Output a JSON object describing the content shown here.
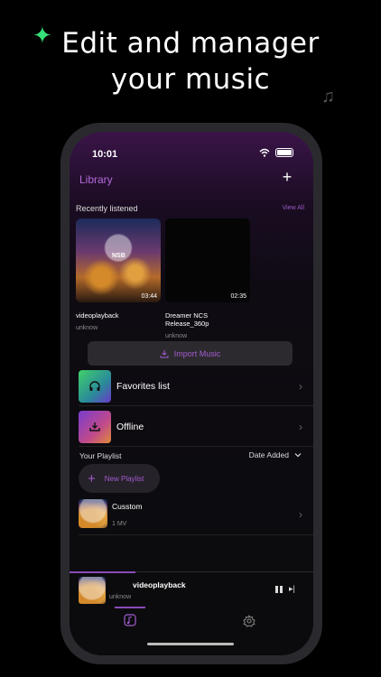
{
  "promo": {
    "headline": "Edit and manager your music"
  },
  "status": {
    "time": "10:01"
  },
  "header": {
    "title": "Library",
    "add_label": "+"
  },
  "recent": {
    "heading": "Recently listened",
    "view_all": "View All",
    "items": [
      {
        "title": "videoplayback",
        "artist": "unknow",
        "duration": "03:44",
        "logo_text": "NSB"
      },
      {
        "title": "Dreamer NCS Release_360p",
        "artist": "unknow",
        "duration": "02:35"
      }
    ]
  },
  "import": {
    "label": "Import Music"
  },
  "library_lists": [
    {
      "label": "Favorites list"
    },
    {
      "label": "Offline"
    }
  ],
  "playlists": {
    "heading": "Your Playlist",
    "sort_label": "Date Added",
    "new_label": "New Playlist",
    "items": [
      {
        "name": "Cusstom",
        "count": "1 MV"
      }
    ]
  },
  "now_playing": {
    "title": "videoplayback",
    "artist": "unknow",
    "progress": 0.27
  },
  "colors": {
    "accent": "#a45cd0",
    "favorites_tile": "#3fd06a",
    "offline_tile": "#7a3cd0"
  },
  "tabs": [
    {
      "icon": "music-library-icon",
      "active": true
    },
    {
      "icon": "gear-icon",
      "active": false
    }
  ]
}
